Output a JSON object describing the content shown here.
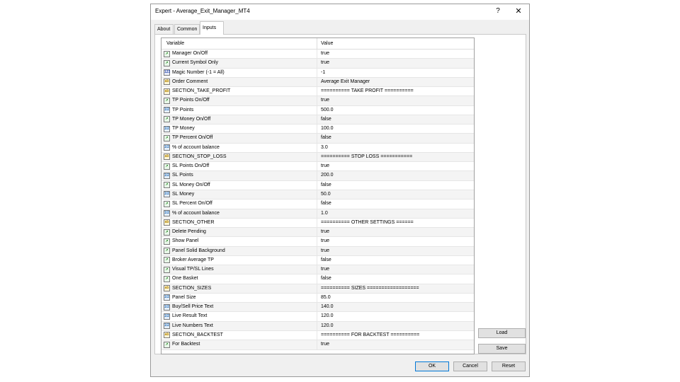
{
  "window": {
    "title": "Expert - Average_Exit_Manager_MT4",
    "help": "?",
    "close": "✕"
  },
  "tabs": [
    {
      "label": "About"
    },
    {
      "label": "Common"
    },
    {
      "label": "Inputs"
    }
  ],
  "grid": {
    "headers": {
      "variable": "Variable",
      "value": "Value"
    },
    "rows": [
      {
        "icon": "bool-icon",
        "name": "Manager On/Off",
        "value": "true"
      },
      {
        "icon": "bool-icon",
        "name": "Current Symbol Only",
        "value": "true"
      },
      {
        "icon": "int-icon",
        "name": "Magic Number (-1 = All)",
        "value": "-1"
      },
      {
        "icon": "string-icon",
        "name": "Order Comment",
        "value": "Average Exit Manager"
      },
      {
        "icon": "string-icon",
        "name": "SECTION_TAKE_PROFIT",
        "value": "========== TAKE PROFIT =========="
      },
      {
        "icon": "bool-icon",
        "name": "TP Points On/Off",
        "value": "true"
      },
      {
        "icon": "double-icon",
        "name": "TP Points",
        "value": "500.0"
      },
      {
        "icon": "bool-icon",
        "name": "TP Money On/Off",
        "value": "false"
      },
      {
        "icon": "double-icon",
        "name": "TP Money",
        "value": "100.0"
      },
      {
        "icon": "bool-icon",
        "name": "TP Percent On/Off",
        "value": "false"
      },
      {
        "icon": "double-icon",
        "name": "% of account balance",
        "value": "3.0"
      },
      {
        "icon": "string-icon",
        "name": "SECTION_STOP_LOSS",
        "value": "========== STOP LOSS ==========="
      },
      {
        "icon": "bool-icon",
        "name": "SL Points On/Off",
        "value": "true"
      },
      {
        "icon": "double-icon",
        "name": "SL Points",
        "value": "200.0"
      },
      {
        "icon": "bool-icon",
        "name": "SL Money On/Off",
        "value": "false"
      },
      {
        "icon": "double-icon",
        "name": "SL Money",
        "value": "50.0"
      },
      {
        "icon": "bool-icon",
        "name": "SL Percent On/Off",
        "value": "false"
      },
      {
        "icon": "double-icon",
        "name": "% of account balance",
        "value": "1.0"
      },
      {
        "icon": "string-icon",
        "name": "SECTION_OTHER",
        "value": "========== OTHER SETTINGS ======"
      },
      {
        "icon": "bool-icon",
        "name": "Delete Pending",
        "value": "true"
      },
      {
        "icon": "bool-icon",
        "name": "Show Panel",
        "value": "true"
      },
      {
        "icon": "bool-icon",
        "name": "Panel Solid Background",
        "value": "true"
      },
      {
        "icon": "bool-icon",
        "name": "Broker Average TP",
        "value": "false"
      },
      {
        "icon": "bool-icon",
        "name": "Visual TP/SL Lines",
        "value": "true"
      },
      {
        "icon": "bool-icon",
        "name": "One Basket",
        "value": "false"
      },
      {
        "icon": "string-icon",
        "name": "SECTION_SIZES",
        "value": "========== SIZES =================="
      },
      {
        "icon": "double-icon",
        "name": "Panel Size",
        "value": "85.0"
      },
      {
        "icon": "double-icon",
        "name": "Buy/Sell Price Text",
        "value": "140.0"
      },
      {
        "icon": "double-icon",
        "name": "Live Result Text",
        "value": "120.0"
      },
      {
        "icon": "double-icon",
        "name": "Live Numbers Text",
        "value": "120.0"
      },
      {
        "icon": "string-icon",
        "name": "SECTION_BACKTEST",
        "value": "========== FOR BACKTEST =========="
      },
      {
        "icon": "bool-icon",
        "name": "For Backtest",
        "value": "true"
      }
    ]
  },
  "buttons": {
    "load": "Load",
    "save": "Save",
    "ok": "OK",
    "cancel": "Cancel",
    "reset": "Reset"
  }
}
